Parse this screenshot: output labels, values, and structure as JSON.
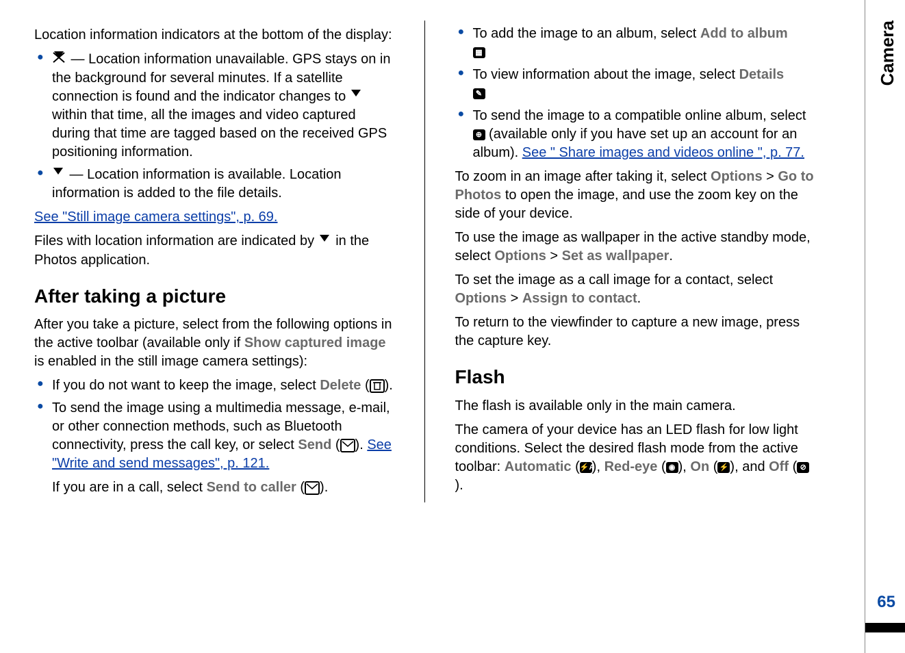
{
  "side_label": "Camera",
  "page_number": "65",
  "left": {
    "intro": "Location information indicators at the bottom of the display:",
    "bullet1_a": " — Location information unavailable. GPS stays on in the background for several minutes. If a satellite connection is found and the indicator changes to ",
    "bullet1_b": " within that time, all the images and video captured during that time are tagged based on the received GPS positioning information.",
    "bullet2": " — Location information is available. Location information is added to the file details.",
    "link1": "See \"Still image camera settings\", p. 69.",
    "files_indicated_a": "Files with location information are indicated by ",
    "files_indicated_b": " in the Photos application.",
    "h2": "After taking a picture",
    "after_intro_a": "After you take a picture, select from the following options in the active toolbar (available only if ",
    "after_intro_bold": "Show captured image",
    "after_intro_b": " is enabled in the still image camera settings):",
    "li_delete_a": "If you do not want to keep the image, select ",
    "li_delete_bold": "Delete",
    "li_delete_b": " (",
    "li_delete_c": ").",
    "li_send_a": "To send the image using a multimedia message, e-mail, or other connection methods, such as Bluetooth connectivity, press the call key, or select ",
    "li_send_bold": "Send",
    "li_send_b": " (",
    "li_send_c": "). ",
    "li_send_link": "See \"Write and send messages\", p. 121.",
    "li_send_sub_a": "If you are in a call, select ",
    "li_send_sub_bold": "Send to caller",
    "li_send_sub_b": " (",
    "li_send_sub_c": ")."
  },
  "right": {
    "li_album_a": "To add the image to an album, select ",
    "li_album_bold": "Add to album ",
    "li_details_a": "To view information about the image, select ",
    "li_details_bold": "Details ",
    "li_online_a": "To send the image to a compatible online album, select ",
    "li_online_b": " (available only if you have set up an account for an album). ",
    "li_online_link": "See \" Share images and videos online \", p. 77.",
    "zoom_a": "To zoom in an image after taking it, select ",
    "zoom_options": "Options",
    "zoom_gt": " > ",
    "zoom_goto": "Go to Photos",
    "zoom_b": " to open the image, and use the zoom key on the side of your device.",
    "wall_a": "To use the image as wallpaper in the active standby mode, select ",
    "wall_set": "Set as wallpaper",
    "wall_dot": ".",
    "assign_a": "To set the image as a call image for a contact, select ",
    "assign_bold": "Assign to contact",
    "assign_dot": ".",
    "return_a": "To return to the viewfinder to capture a new image, press the capture key.",
    "flash_h2": "Flash",
    "flash_p1": "The flash is available only in the main camera.",
    "flash_p2_a": "The camera of your device has an LED flash for low light conditions. Select the desired flash mode from the active toolbar: ",
    "flash_auto": "Automatic",
    "flash_red": "Red-eye",
    "flash_on": "On",
    "flash_off": "Off",
    "flash_paren_open": " (",
    "flash_paren_close": ")",
    "flash_comma": ", ",
    "flash_and": ", and ",
    "flash_dot": "."
  }
}
